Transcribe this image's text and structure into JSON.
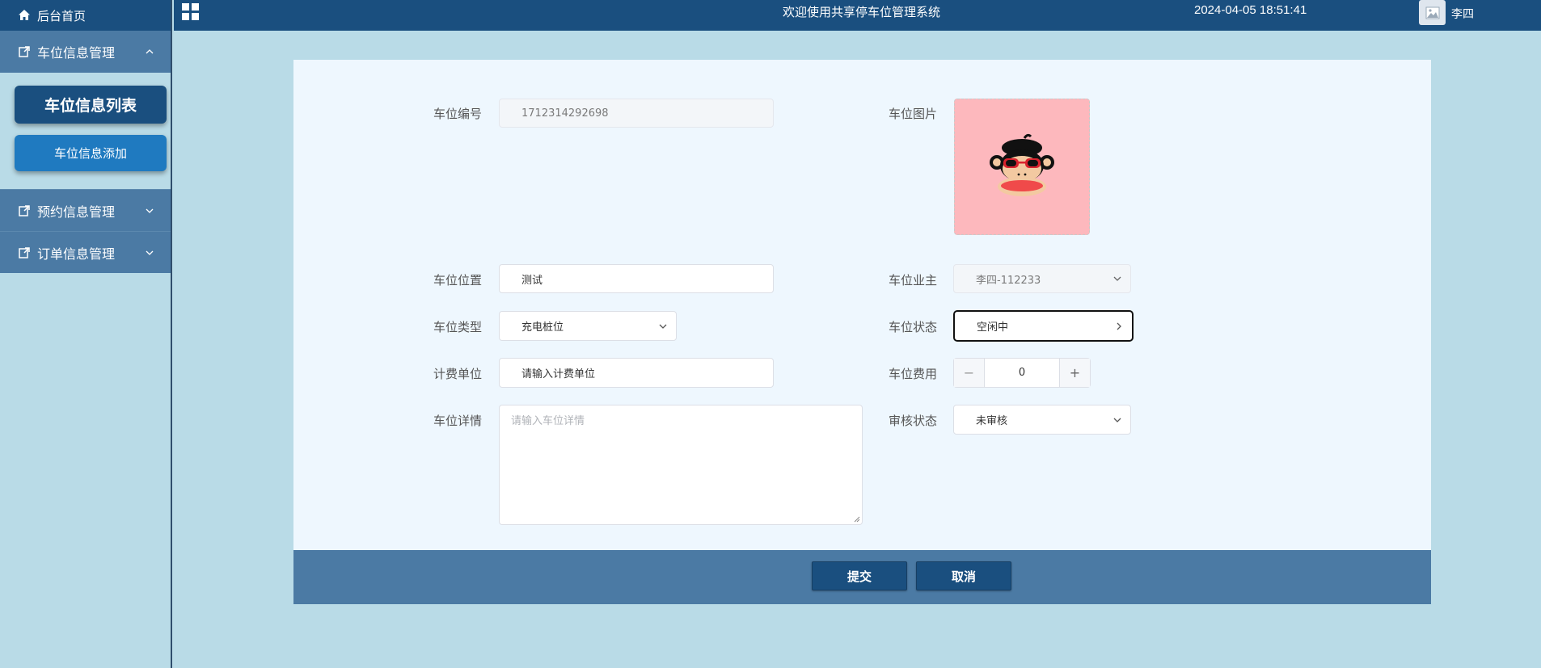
{
  "sidebar": {
    "home_label": "后台首页",
    "groups": [
      {
        "label": "车位信息管理",
        "expanded": true,
        "children": [
          "车位信息列表",
          "车位信息添加"
        ]
      },
      {
        "label": "预约信息管理",
        "expanded": false
      },
      {
        "label": "订单信息管理",
        "expanded": false
      }
    ]
  },
  "header": {
    "welcome": "欢迎使用共享停车位管理系统",
    "datetime": "2024-04-05 18:51:41",
    "username": "李四"
  },
  "form": {
    "labels": {
      "code": "车位编号",
      "photo": "车位图片",
      "location": "车位位置",
      "owner": "车位业主",
      "type": "车位类型",
      "status": "车位状态",
      "unit": "计费单位",
      "fee": "车位费用",
      "detail": "车位详情",
      "audit": "审核状态"
    },
    "values": {
      "code": "1712314292698",
      "location": "测试",
      "owner": "李四-112233",
      "type": "充电桩位",
      "status": "空闲中",
      "unit": "请输入计费单位",
      "fee": "0",
      "audit": "未审核"
    },
    "placeholders": {
      "detail": "请输入车位详情"
    },
    "stepper": {
      "minus": "−",
      "plus": "+"
    }
  },
  "actions": {
    "submit": "提交",
    "cancel": "取消"
  },
  "colors": {
    "primary": "#1a4f7f",
    "sidebar_group": "#4b7aa4",
    "background": "#b9dbe7",
    "panel": "#eef7fe",
    "photo_bg": "#fdb8bd"
  }
}
